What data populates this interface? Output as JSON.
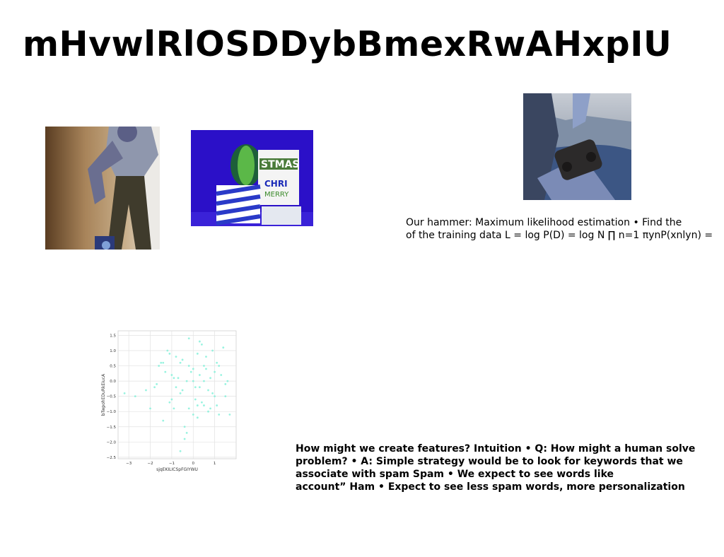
{
  "slide": {
    "title": "mHvwlRlOSDDybBmexRwAHxpIU",
    "mle_lines": [
      "Our hammer: Maximum likelihood estimation • Find the",
      "of the training data L = log P(D) = log N ∏ n=1 πynP(xnlyn) ="
    ],
    "feature_lines": [
      "How might we create features? Intuition • Q: How might a human solve",
      "problem? • A: Simple strategy would be to look for keywords that we",
      "associate with spam Spam • We expect to see words like",
      "account” Ham • Expect to see less spam words, more personalization"
    ]
  },
  "chart_data": {
    "type": "scatter",
    "xlabel": "sjqEKILICSpFGIYWU",
    "ylabel": "bTwpohEDuRkEiucA",
    "xlim": [
      -3.5,
      2.0
    ],
    "ylim": [
      -2.55,
      1.65
    ],
    "xticks": [
      "−3",
      "−2",
      "−1",
      "0",
      "1"
    ],
    "yticks": [
      "1.5",
      "1.0",
      "0.5",
      "0.0",
      "−0.5",
      "−1.0",
      "−1.5",
      "−2.0",
      "−2.5"
    ],
    "grid": true,
    "color": "#7ff0d8",
    "points": [
      [
        -3.2,
        -0.4
      ],
      [
        -2.7,
        -0.5
      ],
      [
        -2.2,
        -0.3
      ],
      [
        -2.0,
        -0.9
      ],
      [
        -1.8,
        -0.2
      ],
      [
        -1.6,
        0.5
      ],
      [
        -1.5,
        0.6
      ],
      [
        -1.4,
        -1.3
      ],
      [
        -1.3,
        0.3
      ],
      [
        -1.2,
        1.0
      ],
      [
        -1.1,
        -0.7
      ],
      [
        -1.0,
        0.2
      ],
      [
        -0.9,
        -0.9
      ],
      [
        -0.8,
        0.8
      ],
      [
        -0.7,
        0.1
      ],
      [
        -0.6,
        -0.4
      ],
      [
        -0.5,
        0.7
      ],
      [
        -0.4,
        -1.5
      ],
      [
        -0.3,
        -1.7
      ],
      [
        -0.2,
        1.4
      ],
      [
        -0.1,
        0.3
      ],
      [
        0.0,
        0.0
      ],
      [
        0.1,
        -0.6
      ],
      [
        0.2,
        0.9
      ],
      [
        0.3,
        -0.2
      ],
      [
        0.4,
        1.2
      ],
      [
        0.5,
        -0.8
      ],
      [
        0.6,
        0.4
      ],
      [
        0.7,
        -0.3
      ],
      [
        0.8,
        0.1
      ],
      [
        0.9,
        1.0
      ],
      [
        1.0,
        -0.5
      ],
      [
        1.1,
        0.6
      ],
      [
        1.2,
        -1.1
      ],
      [
        1.3,
        0.2
      ],
      [
        1.4,
        1.1
      ],
      [
        1.5,
        -0.1
      ],
      [
        1.6,
        0.0
      ],
      [
        1.7,
        -1.1
      ],
      [
        -1.7,
        -0.1
      ],
      [
        -0.6,
        -2.3
      ],
      [
        0.0,
        -1.1
      ],
      [
        0.2,
        -0.8
      ],
      [
        0.3,
        0.2
      ],
      [
        -0.2,
        0.5
      ],
      [
        0.5,
        0.0
      ],
      [
        0.8,
        -0.9
      ],
      [
        -1.0,
        -0.6
      ],
      [
        -0.3,
        0.0
      ],
      [
        1.0,
        0.3
      ],
      [
        0.4,
        -0.7
      ],
      [
        -0.8,
        -0.2
      ],
      [
        0.6,
        0.8
      ],
      [
        -1.4,
        0.6
      ],
      [
        1.2,
        0.5
      ],
      [
        0.0,
        0.4
      ],
      [
        -0.5,
        -0.3
      ],
      [
        0.7,
        -1.0
      ],
      [
        -1.1,
        0.9
      ],
      [
        0.1,
        -0.2
      ],
      [
        0.9,
        -0.4
      ],
      [
        -0.2,
        -0.9
      ],
      [
        0.3,
        1.3
      ],
      [
        1.5,
        -0.5
      ],
      [
        -0.6,
        0.6
      ],
      [
        0.2,
        -1.2
      ],
      [
        -0.9,
        0.1
      ],
      [
        0.5,
        0.5
      ],
      [
        -0.4,
        -1.9
      ],
      [
        1.1,
        -0.8
      ]
    ]
  }
}
